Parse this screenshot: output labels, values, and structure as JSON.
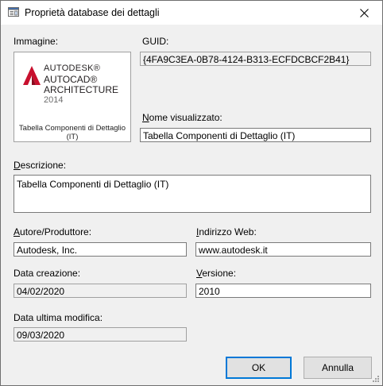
{
  "window": {
    "title": "Proprietà database dei dettagli"
  },
  "labels": {
    "image": "Immagine:",
    "guid": "GUID:",
    "display_name": "Nome visualizzato:",
    "description": "Descrizione:",
    "author": "Autore/Produttore:",
    "web": "Indirizzo Web:",
    "created": "Data creazione:",
    "version": "Versione:",
    "modified": "Data ultima modifica:"
  },
  "values": {
    "guid": "{4FA9C3EA-0B78-4124-B313-ECFDCBCF2B41}",
    "display_name": "Tabella Componenti di Dettaglio (IT)",
    "description": "Tabella Componenti di Dettaglio (IT)",
    "author": "Autodesk, Inc.",
    "web": "www.autodesk.it",
    "created": "04/02/2020",
    "version": "2010",
    "modified": "09/03/2020"
  },
  "image": {
    "logo_line1": "AUTODESK®",
    "logo_line2": "AUTOCAD®",
    "logo_line3": "ARCHITECTURE",
    "logo_line4": "2014",
    "caption": "Tabella Componenti di Dettaglio (IT)"
  },
  "buttons": {
    "ok": "OK",
    "cancel": "Annulla"
  },
  "colors": {
    "accent": "#0078d7",
    "logo_red": "#c8102e"
  },
  "icons": {
    "title": "database-properties-icon",
    "close": "close-icon",
    "logo": "autocad-logo-icon",
    "grip": "resize-grip-icon"
  }
}
